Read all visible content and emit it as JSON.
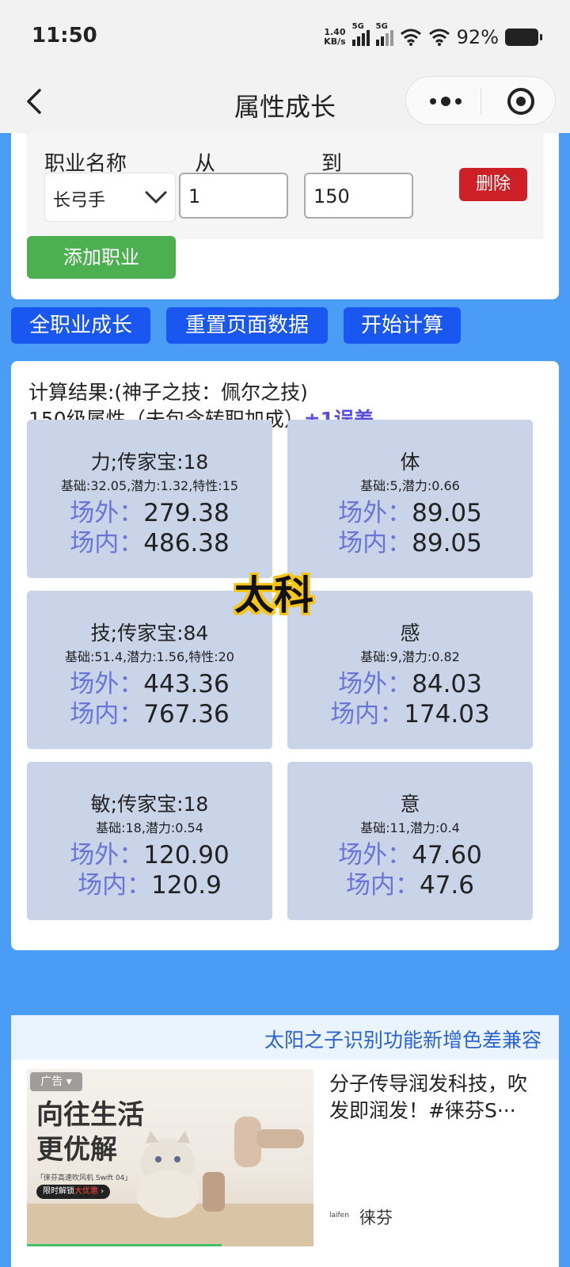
{
  "status_bar": {
    "time": "11:50",
    "net_speed_value": "1.40",
    "net_speed_unit": "KB/s",
    "sim1": "5G",
    "sim2": "5G",
    "battery": "92%"
  },
  "nav": {
    "title": "属性成长"
  },
  "job_form": {
    "job_label": "职业名称",
    "from_label": "从",
    "to_label": "到",
    "job_value": "长弓手",
    "from_value": "1",
    "to_value": "150",
    "delete_label": "删除",
    "add_label": "添加职业"
  },
  "actions": {
    "all_jobs": "全职业成长",
    "reset": "重置页面数据",
    "calculate": "开始计算"
  },
  "result": {
    "line1": "计算结果:(神子之技：佩尔之技)",
    "line2": "150级属性（未包含转职加成）",
    "error_note": "±1误差",
    "outside_label": "场外：",
    "inside_label": "场内：",
    "stats": [
      {
        "name": "力;传家宝:18",
        "base": "基础:32.05,潜力:1.32,特性:15",
        "outside": "279.38",
        "inside": "486.38"
      },
      {
        "name": "体",
        "base": "基础:5,潜力:0.66",
        "outside": "89.05",
        "inside": "89.05"
      },
      {
        "name": "技;传家宝:84",
        "base": "基础:51.4,潜力:1.56,特性:20",
        "outside": "443.36",
        "inside": "767.36"
      },
      {
        "name": "感",
        "base": "基础:9,潜力:0.82",
        "outside": "84.03",
        "inside": "174.03"
      },
      {
        "name": "敏;传家宝:18",
        "base": "基础:18,潜力:0.54",
        "outside": "120.90",
        "inside": "120.9"
      },
      {
        "name": "意",
        "base": "基础:11,潜力:0.4",
        "outside": "47.60",
        "inside": "47.6"
      }
    ]
  },
  "watermark": "太科",
  "marquee": "太阳之子识别功能新增色差兼容",
  "ad": {
    "tag": "广告",
    "headline1": "向往生活",
    "headline2": "更优解",
    "small_text": "「徕芬高速吹风机 Swift 04」",
    "pill_text": "限时解锁",
    "pill_hot": "大优惠",
    "title": "分子传导润发科技，吹发即润发！#徕芬S···",
    "brand_logo": "laifen",
    "brand": "徕芬",
    "progress": 0.68
  }
}
